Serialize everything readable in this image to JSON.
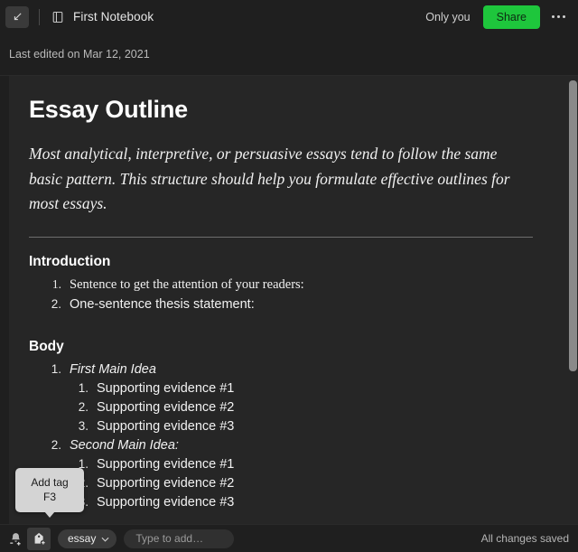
{
  "header": {
    "collapse_icon": "collapse-arrow-icon",
    "notebook_icon": "notebook-icon",
    "notebook_title": "First Notebook",
    "permission_label": "Only you",
    "share_label": "Share",
    "more_icon": "more-options-icon",
    "share_color": "#1ec63c"
  },
  "subheader": {
    "last_edited": "Last edited on Mar 12, 2021"
  },
  "note": {
    "title": "Essay Outline",
    "intro": "Most analytical, interpretive, or persuasive essays tend to follow the same basic pattern. This structure should help you formulate effective outlines for most essays.",
    "sections": [
      {
        "heading": "Introduction",
        "items": [
          {
            "num": "1.",
            "text": "Sentence to get the attention of your readers:",
            "style": "serif"
          },
          {
            "num": "2.",
            "text": "One-sentence thesis statement:",
            "style": "sans"
          }
        ]
      },
      {
        "heading": "Body",
        "items": [
          {
            "num": "1.",
            "text": "First Main Idea",
            "style": "sans-italic"
          },
          {
            "num": "1.",
            "text": "Supporting evidence #1",
            "style": "sans",
            "level": 2
          },
          {
            "num": "2.",
            "text": "Supporting evidence #2",
            "style": "sans",
            "level": 2
          },
          {
            "num": "3.",
            "text": "Supporting evidence #3",
            "style": "sans",
            "level": 2
          },
          {
            "num": "2.",
            "text": "Second Main Idea:",
            "style": "sans-italic"
          },
          {
            "num": "1.",
            "text": "Supporting evidence #1",
            "style": "sans",
            "level": 2
          },
          {
            "num": "2.",
            "text": "Supporting evidence #2",
            "style": "sans",
            "level": 2
          },
          {
            "num": "3.",
            "text": "Supporting evidence #3",
            "style": "sans",
            "level": 2
          }
        ]
      }
    ]
  },
  "tooltip": {
    "line1": "Add tag",
    "line2": "F3"
  },
  "tagbar": {
    "reminder_icon": "bell-add-icon",
    "add_tag_icon": "tag-add-icon",
    "tag_chip_label": "essay",
    "tag_chip_chevron": "chevron-down-icon",
    "tag_input_placeholder": "Type to add…",
    "tag_input_value": "",
    "status": "All changes saved"
  }
}
